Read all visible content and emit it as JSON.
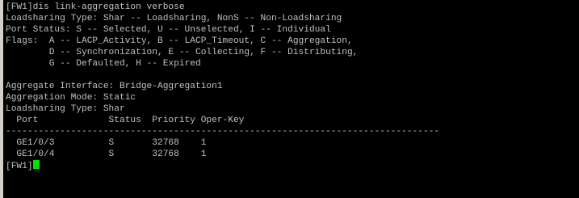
{
  "terminal": {
    "lines": [
      "[FW1]dis link-aggregation verbose",
      "Loadsharing Type: Shar -- Loadsharing, NonS -- Non-Loadsharing",
      "Port Status: S -- Selected, U -- Unselected, I -- Individual",
      "Flags:  A -- LACP_Activity, B -- LACP_Timeout, C -- Aggregation,",
      "        D -- Synchronization, E -- Collecting, F -- Distributing,",
      "        G -- Defaulted, H -- Expired",
      "",
      "Aggregate Interface: Bridge-Aggregation1",
      "Aggregation Mode: Static",
      "Loadsharing Type: Shar",
      "  Port             Status  Priority Oper-Key",
      "--------------------------------------------------------------------------------",
      "  GE1/0/3          S       32768    1",
      "  GE1/0/4          S       32768    1"
    ],
    "prompt": "[FW1]",
    "cursor_color": "#00e000",
    "text_color": "#c0c0c0",
    "background_color": "#000000"
  }
}
